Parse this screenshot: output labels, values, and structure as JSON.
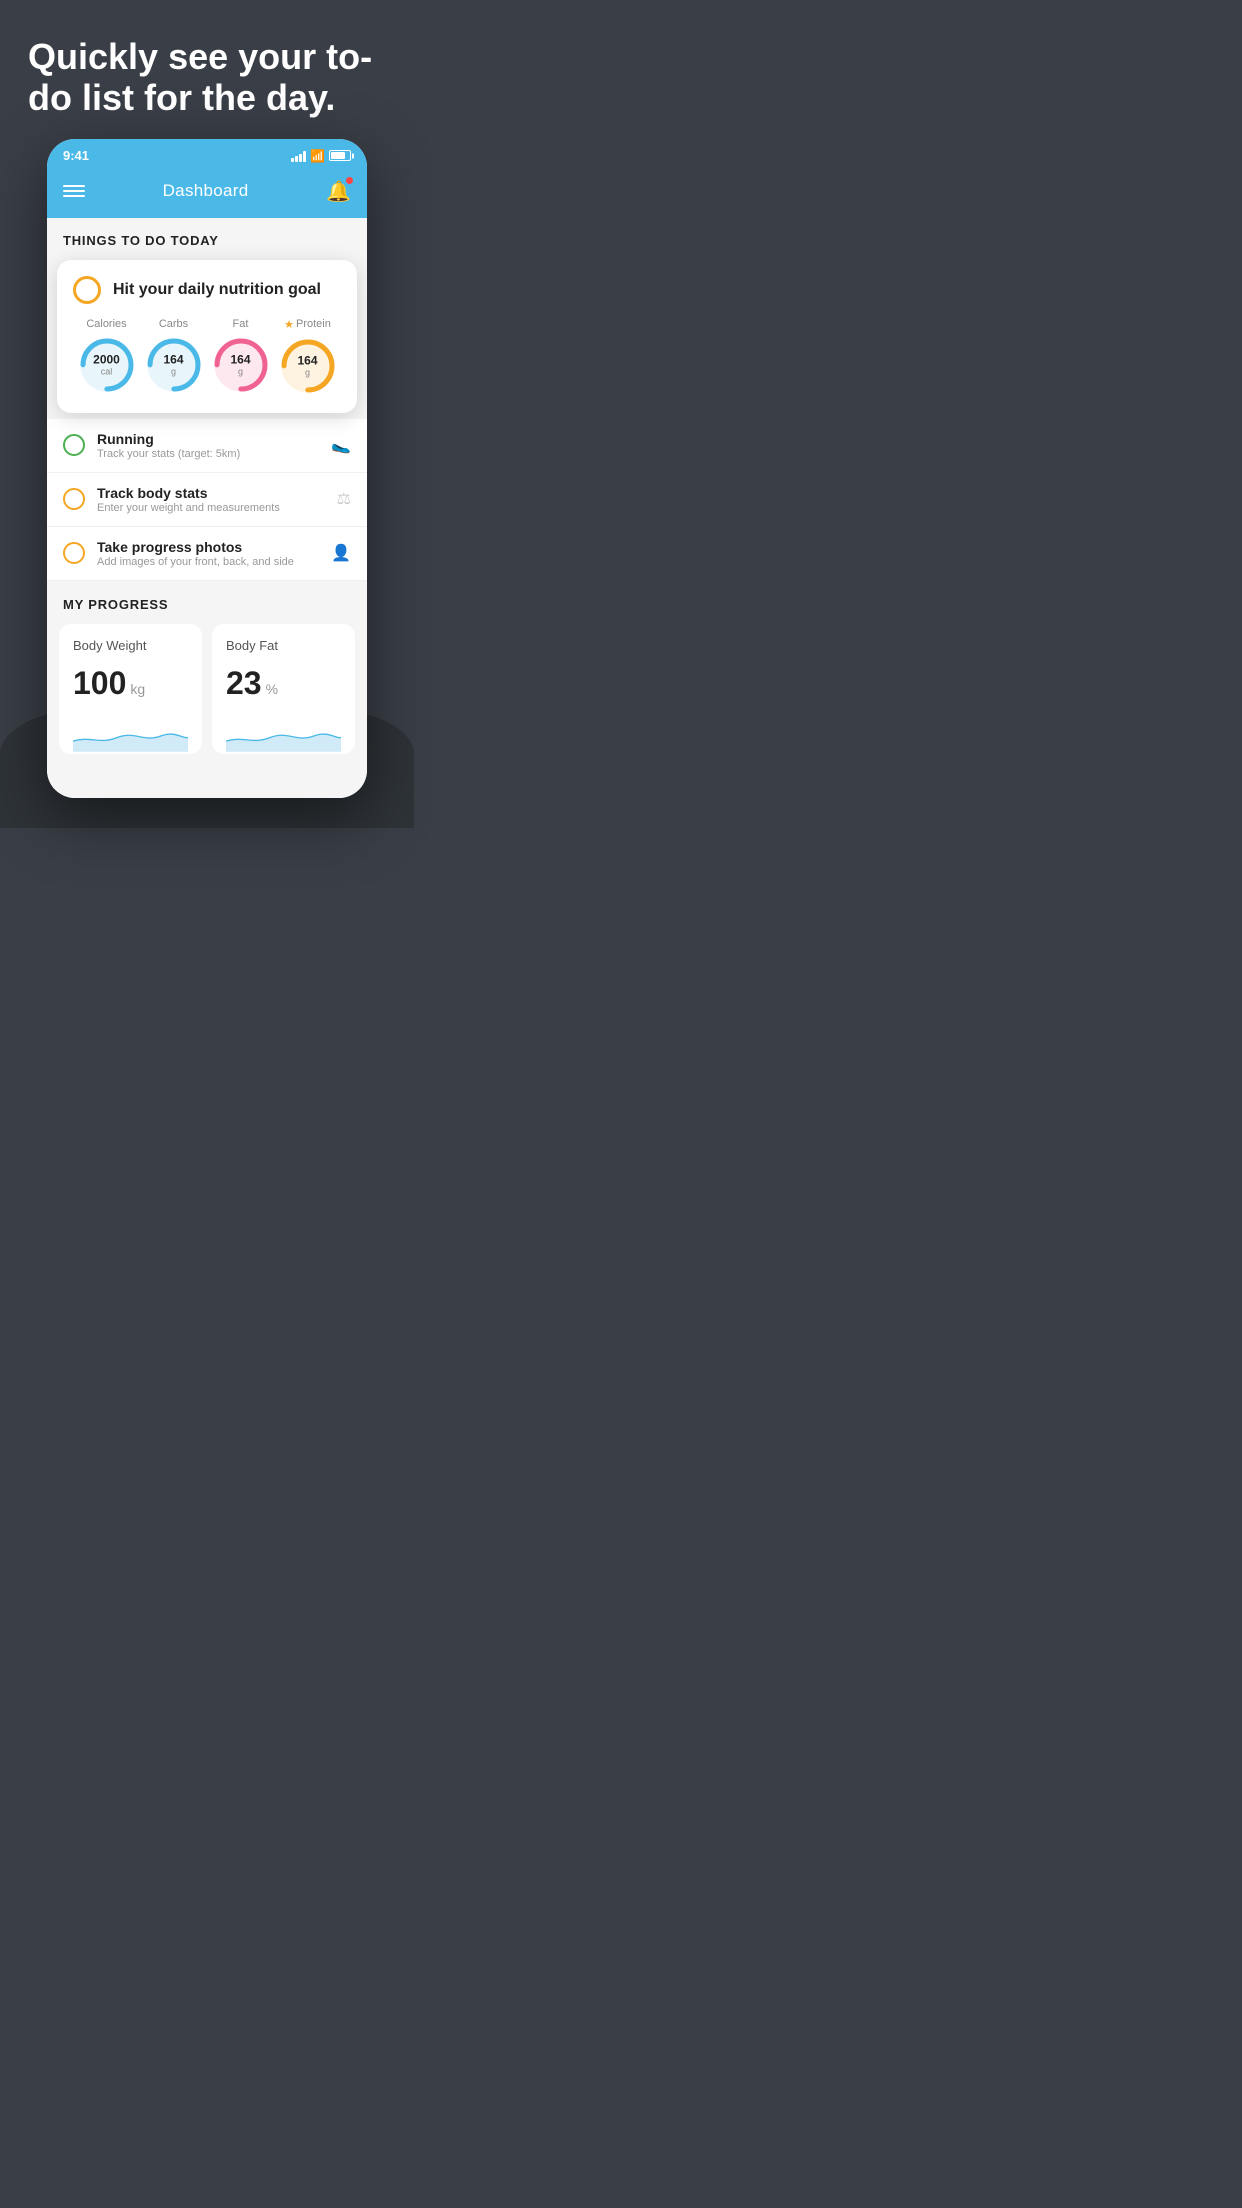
{
  "hero": {
    "title": "Quickly see your to-do list for the day."
  },
  "statusBar": {
    "time": "9:41"
  },
  "header": {
    "title": "Dashboard"
  },
  "sectionToday": {
    "title": "THINGS TO DO TODAY"
  },
  "nutritionCard": {
    "title": "Hit your daily nutrition goal",
    "rings": [
      {
        "label": "Calories",
        "value": "2000",
        "unit": "cal",
        "color": "#4ab9e8",
        "bg": "#e8f6fc",
        "starred": false
      },
      {
        "label": "Carbs",
        "value": "164",
        "unit": "g",
        "color": "#4ab9e8",
        "bg": "#e8f6fc",
        "starred": false
      },
      {
        "label": "Fat",
        "value": "164",
        "unit": "g",
        "color": "#f06292",
        "bg": "#fde8ef",
        "starred": false
      },
      {
        "label": "Protein",
        "value": "164",
        "unit": "g",
        "color": "#f5a623",
        "bg": "#fef3e0",
        "starred": true
      }
    ]
  },
  "todoItems": [
    {
      "name": "Running",
      "sub": "Track your stats (target: 5km)",
      "circleColor": "green",
      "icon": "🥿"
    },
    {
      "name": "Track body stats",
      "sub": "Enter your weight and measurements",
      "circleColor": "yellow",
      "icon": "⚖"
    },
    {
      "name": "Take progress photos",
      "sub": "Add images of your front, back, and side",
      "circleColor": "yellow",
      "icon": "👤"
    }
  ],
  "progressSection": {
    "title": "MY PROGRESS",
    "cards": [
      {
        "title": "Body Weight",
        "value": "100",
        "unit": "kg"
      },
      {
        "title": "Body Fat",
        "value": "23",
        "unit": "%"
      }
    ]
  }
}
